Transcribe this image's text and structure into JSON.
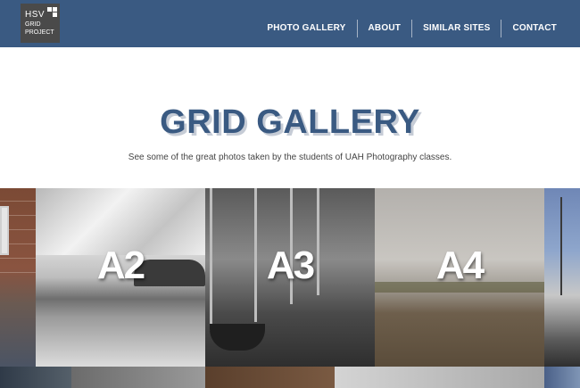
{
  "brand": {
    "line1": "HSV",
    "line2": "GRID",
    "line3": "PROJECT"
  },
  "nav": {
    "items": [
      {
        "label": "PHOTO GALLERY"
      },
      {
        "label": "ABOUT"
      },
      {
        "label": "SIMILAR SITES"
      },
      {
        "label": "CONTACT"
      }
    ]
  },
  "hero": {
    "title": "GRID GALLERY",
    "subtitle": "See some of the great photos taken by the students of UAH Photography classes."
  },
  "gallery": {
    "tiles": [
      {
        "label": "A2"
      },
      {
        "label": "A3"
      },
      {
        "label": "A4"
      }
    ]
  },
  "colors": {
    "nav_background": "#3a5a82",
    "title_color": "#3a5a82",
    "logo_background": "#4a4a4a"
  }
}
